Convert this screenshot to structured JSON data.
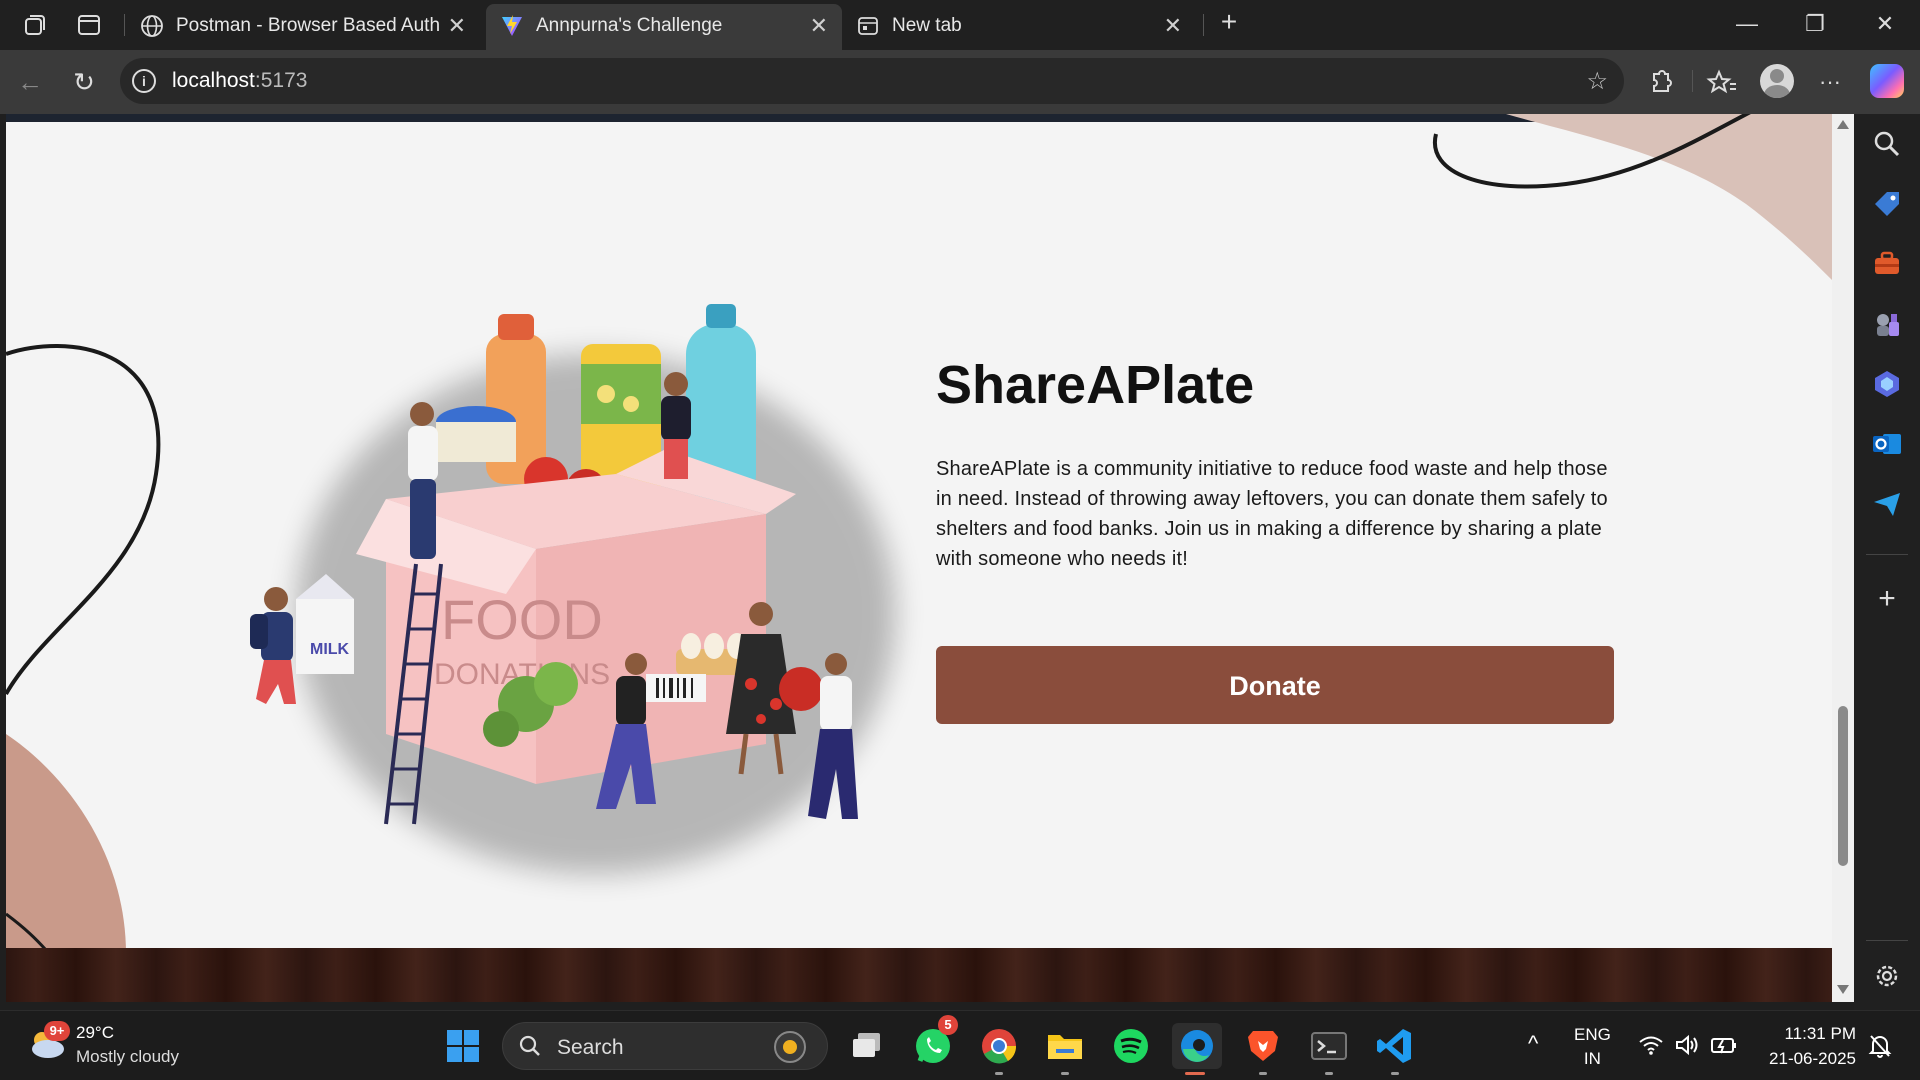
{
  "browser": {
    "tabs": [
      {
        "title": "Postman - Browser Based Auth",
        "active": false
      },
      {
        "title": "Annpurna's Challenge",
        "active": true
      },
      {
        "title": "New tab",
        "active": false
      }
    ],
    "url_host": "localhost",
    "url_port": ":5173"
  },
  "page": {
    "brand": "ShareAPlate",
    "description": "ShareAPlate is a community initiative to reduce food waste and help those in need. Instead of throwing away leftovers, you can donate them safely to shelters and food banks. Join us in making a difference by sharing a plate with someone who needs it!",
    "donate_label": "Donate",
    "illustration_text": {
      "food": "FOOD",
      "donations": "DONATIONS",
      "milk": "MILK"
    },
    "colors": {
      "accent": "#8a4d3c",
      "background": "#f4f4f4",
      "blob": "#c99a8a"
    }
  },
  "taskbar": {
    "weather_temp": "29°C",
    "weather_desc": "Mostly cloudy",
    "weather_badge": "9+",
    "search_placeholder": "Search",
    "whatsapp_badge": "5",
    "lang_line1": "ENG",
    "lang_line2": "IN",
    "time": "11:31 PM",
    "date": "21-06-2025"
  }
}
